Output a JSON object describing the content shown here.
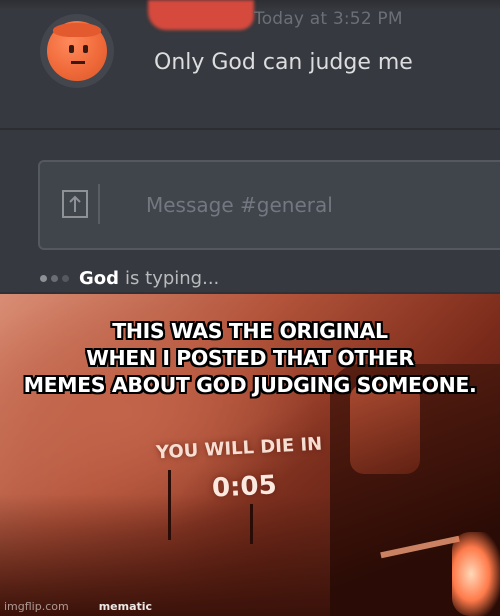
{
  "chat": {
    "timestamp": "Today at 3:52 PM",
    "message": "Only God can judge me",
    "composer_placeholder": "Message #general",
    "typing": {
      "user": "God",
      "suffix": "is typing..."
    }
  },
  "meme": {
    "caption_lines": [
      "THIS WAS THE ORIGINAL",
      "WHEN I POSTED THAT OTHER",
      "MEMES ABOUT GOD JUDGING SOMEONE."
    ],
    "overlay_text": "YOU WILL DIE IN",
    "countdown": "0:05"
  },
  "watermarks": {
    "site": "imgflip.com",
    "app": "mematic"
  },
  "colors": {
    "chat_bg": "#36393f",
    "composer_bg": "#40444b",
    "avatar_orange": "#f06a3a",
    "meme_red": "#b2533a"
  }
}
